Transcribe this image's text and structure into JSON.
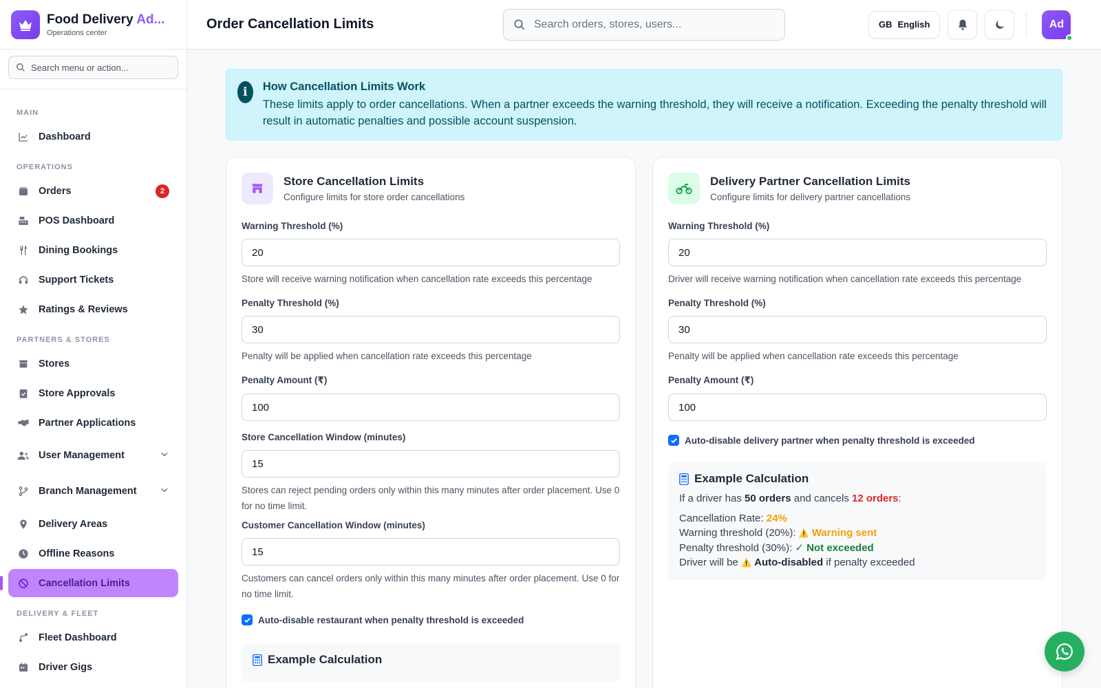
{
  "brand": {
    "title_main": "Food Delivery ",
    "title_accent": "Ad...",
    "subtitle": "Operations center"
  },
  "sidebar": {
    "search_placeholder": "Search menu or action...",
    "sections": {
      "main": "MAIN",
      "operations": "OPERATIONS",
      "partners": "PARTNERS & STORES",
      "delivery": "DELIVERY & FLEET"
    },
    "items": {
      "dashboard": "Dashboard",
      "orders": "Orders",
      "orders_badge": "2",
      "pos": "POS Dashboard",
      "dining": "Dining Bookings",
      "support": "Support Tickets",
      "ratings": "Ratings & Reviews",
      "stores": "Stores",
      "store_approvals": "Store Approvals",
      "partner_apps": "Partner Applications",
      "user_mgmt": "User Management",
      "branch_mgmt": "Branch Management",
      "delivery_areas": "Delivery Areas",
      "offline_reasons": "Offline Reasons",
      "cancellation_limits": "Cancellation Limits",
      "fleet_dashboard": "Fleet Dashboard",
      "driver_gigs": "Driver Gigs"
    }
  },
  "header": {
    "title": "Order Cancellation Limits",
    "search_placeholder": "Search orders, stores, users...",
    "lang_flag": "GB",
    "lang_label": "English",
    "avatar_initials": "Ad"
  },
  "info": {
    "title": "How Cancellation Limits Work",
    "body": "These limits apply to order cancellations. When a partner exceeds the warning threshold, they will receive a notification. Exceeding the penalty threshold will result in automatic penalties and possible account suspension."
  },
  "store_card": {
    "title": "Store Cancellation Limits",
    "subtitle": "Configure limits for store order cancellations",
    "warning_label": "Warning Threshold (%)",
    "warning_value": "20",
    "warning_help": "Store will receive warning notification when cancellation rate exceeds this percentage",
    "penalty_label": "Penalty Threshold (%)",
    "penalty_value": "30",
    "penalty_help": "Penalty will be applied when cancellation rate exceeds this percentage",
    "amount_label": "Penalty Amount (₹)",
    "amount_value": "100",
    "store_window_label": "Store Cancellation Window (minutes)",
    "store_window_value": "15",
    "store_window_help": "Stores can reject pending orders only within this many minutes after order placement. Use 0 for no time limit.",
    "customer_window_label": "Customer Cancellation Window (minutes)",
    "customer_window_value": "15",
    "customer_window_help": "Customers can cancel orders only within this many minutes after order placement. Use 0 for no time limit.",
    "auto_disable_label": "Auto-disable restaurant when penalty threshold is exceeded",
    "example_title": "Example Calculation"
  },
  "driver_card": {
    "title": "Delivery Partner Cancellation Limits",
    "subtitle": "Configure limits for delivery partner cancellations",
    "warning_label": "Warning Threshold (%)",
    "warning_value": "20",
    "warning_help": "Driver will receive warning notification when cancellation rate exceeds this percentage",
    "penalty_label": "Penalty Threshold (%)",
    "penalty_value": "30",
    "penalty_help": "Penalty will be applied when cancellation rate exceeds this percentage",
    "amount_label": "Penalty Amount (₹)",
    "amount_value": "100",
    "auto_disable_label": "Auto-disable delivery partner when penalty threshold is exceeded",
    "example": {
      "title": "Example Calculation",
      "l1_a": "If a driver has ",
      "l1_orders": "50 orders",
      "l1_b": " and cancels ",
      "l1_cancels": "12 orders",
      "l1_c": ":",
      "rate_label": "Cancellation Rate: ",
      "rate_value": "24%",
      "warn_label": "Warning threshold (20%): ",
      "warn_icon": "⚠️",
      "warn_value": "Warning sent",
      "pen_label": "Penalty threshold (30%): ",
      "pen_icon": "✓",
      "pen_value": "Not exceeded",
      "dis_a": "Driver will be ",
      "dis_icon": "⚠️",
      "dis_b": "Auto-disabled",
      "dis_c": " if penalty exceeded"
    }
  },
  "colors": {
    "accent": "#8b5cf6",
    "active_nav": "#c084fc",
    "info_bg": "#cff4fc",
    "whatsapp": "#25b061"
  }
}
